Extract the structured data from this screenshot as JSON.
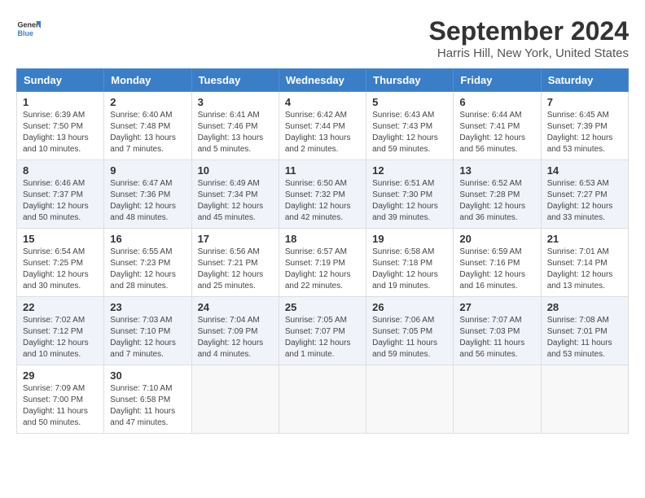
{
  "header": {
    "logo_general": "General",
    "logo_blue": "Blue",
    "title": "September 2024",
    "subtitle": "Harris Hill, New York, United States"
  },
  "days_of_week": [
    "Sunday",
    "Monday",
    "Tuesday",
    "Wednesday",
    "Thursday",
    "Friday",
    "Saturday"
  ],
  "weeks": [
    [
      {
        "day": "1",
        "sunrise": "6:39 AM",
        "sunset": "7:50 PM",
        "daylight": "13 hours and 10 minutes."
      },
      {
        "day": "2",
        "sunrise": "6:40 AM",
        "sunset": "7:48 PM",
        "daylight": "13 hours and 7 minutes."
      },
      {
        "day": "3",
        "sunrise": "6:41 AM",
        "sunset": "7:46 PM",
        "daylight": "13 hours and 5 minutes."
      },
      {
        "day": "4",
        "sunrise": "6:42 AM",
        "sunset": "7:44 PM",
        "daylight": "13 hours and 2 minutes."
      },
      {
        "day": "5",
        "sunrise": "6:43 AM",
        "sunset": "7:43 PM",
        "daylight": "12 hours and 59 minutes."
      },
      {
        "day": "6",
        "sunrise": "6:44 AM",
        "sunset": "7:41 PM",
        "daylight": "12 hours and 56 minutes."
      },
      {
        "day": "7",
        "sunrise": "6:45 AM",
        "sunset": "7:39 PM",
        "daylight": "12 hours and 53 minutes."
      }
    ],
    [
      {
        "day": "8",
        "sunrise": "6:46 AM",
        "sunset": "7:37 PM",
        "daylight": "12 hours and 50 minutes."
      },
      {
        "day": "9",
        "sunrise": "6:47 AM",
        "sunset": "7:36 PM",
        "daylight": "12 hours and 48 minutes."
      },
      {
        "day": "10",
        "sunrise": "6:49 AM",
        "sunset": "7:34 PM",
        "daylight": "12 hours and 45 minutes."
      },
      {
        "day": "11",
        "sunrise": "6:50 AM",
        "sunset": "7:32 PM",
        "daylight": "12 hours and 42 minutes."
      },
      {
        "day": "12",
        "sunrise": "6:51 AM",
        "sunset": "7:30 PM",
        "daylight": "12 hours and 39 minutes."
      },
      {
        "day": "13",
        "sunrise": "6:52 AM",
        "sunset": "7:28 PM",
        "daylight": "12 hours and 36 minutes."
      },
      {
        "day": "14",
        "sunrise": "6:53 AM",
        "sunset": "7:27 PM",
        "daylight": "12 hours and 33 minutes."
      }
    ],
    [
      {
        "day": "15",
        "sunrise": "6:54 AM",
        "sunset": "7:25 PM",
        "daylight": "12 hours and 30 minutes."
      },
      {
        "day": "16",
        "sunrise": "6:55 AM",
        "sunset": "7:23 PM",
        "daylight": "12 hours and 28 minutes."
      },
      {
        "day": "17",
        "sunrise": "6:56 AM",
        "sunset": "7:21 PM",
        "daylight": "12 hours and 25 minutes."
      },
      {
        "day": "18",
        "sunrise": "6:57 AM",
        "sunset": "7:19 PM",
        "daylight": "12 hours and 22 minutes."
      },
      {
        "day": "19",
        "sunrise": "6:58 AM",
        "sunset": "7:18 PM",
        "daylight": "12 hours and 19 minutes."
      },
      {
        "day": "20",
        "sunrise": "6:59 AM",
        "sunset": "7:16 PM",
        "daylight": "12 hours and 16 minutes."
      },
      {
        "day": "21",
        "sunrise": "7:01 AM",
        "sunset": "7:14 PM",
        "daylight": "12 hours and 13 minutes."
      }
    ],
    [
      {
        "day": "22",
        "sunrise": "7:02 AM",
        "sunset": "7:12 PM",
        "daylight": "12 hours and 10 minutes."
      },
      {
        "day": "23",
        "sunrise": "7:03 AM",
        "sunset": "7:10 PM",
        "daylight": "12 hours and 7 minutes."
      },
      {
        "day": "24",
        "sunrise": "7:04 AM",
        "sunset": "7:09 PM",
        "daylight": "12 hours and 4 minutes."
      },
      {
        "day": "25",
        "sunrise": "7:05 AM",
        "sunset": "7:07 PM",
        "daylight": "12 hours and 1 minute."
      },
      {
        "day": "26",
        "sunrise": "7:06 AM",
        "sunset": "7:05 PM",
        "daylight": "11 hours and 59 minutes."
      },
      {
        "day": "27",
        "sunrise": "7:07 AM",
        "sunset": "7:03 PM",
        "daylight": "11 hours and 56 minutes."
      },
      {
        "day": "28",
        "sunrise": "7:08 AM",
        "sunset": "7:01 PM",
        "daylight": "11 hours and 53 minutes."
      }
    ],
    [
      {
        "day": "29",
        "sunrise": "7:09 AM",
        "sunset": "7:00 PM",
        "daylight": "11 hours and 50 minutes."
      },
      {
        "day": "30",
        "sunrise": "7:10 AM",
        "sunset": "6:58 PM",
        "daylight": "11 hours and 47 minutes."
      },
      null,
      null,
      null,
      null,
      null
    ]
  ]
}
